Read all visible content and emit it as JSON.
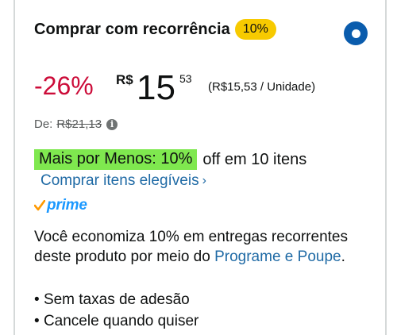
{
  "header": {
    "title": "Comprar com recorrência",
    "badge": "10%"
  },
  "price": {
    "discount": "-26%",
    "currency": "R$",
    "whole": "15",
    "cents": "53",
    "unit_price": "(R$15,53 / Unidade)"
  },
  "list_price": {
    "label": "De:",
    "value": "R$21,13",
    "info_glyph": "i"
  },
  "promotion": {
    "highlight": "Mais por Menos: 10%",
    "rest": "off em 10 itens",
    "link": "Comprar itens elegíveis",
    "chevron": "›"
  },
  "prime": {
    "label": "prime",
    "check_color": "#ff9900"
  },
  "description": {
    "text": "Você economiza 10% em entregas recorrentes deste produto por meio do",
    "link": "Programe e Poupe",
    "tail": "."
  },
  "bullets": [
    "Sem taxas de adesão",
    "Cancele quando quiser"
  ],
  "colors": {
    "accent_blue": "#0a5cad",
    "discount_red": "#cc0c39",
    "badge_yellow": "#f7ca00",
    "promo_green": "#7fe84f",
    "link_blue": "#1f6aa5",
    "prime_blue": "#1a98ff"
  }
}
